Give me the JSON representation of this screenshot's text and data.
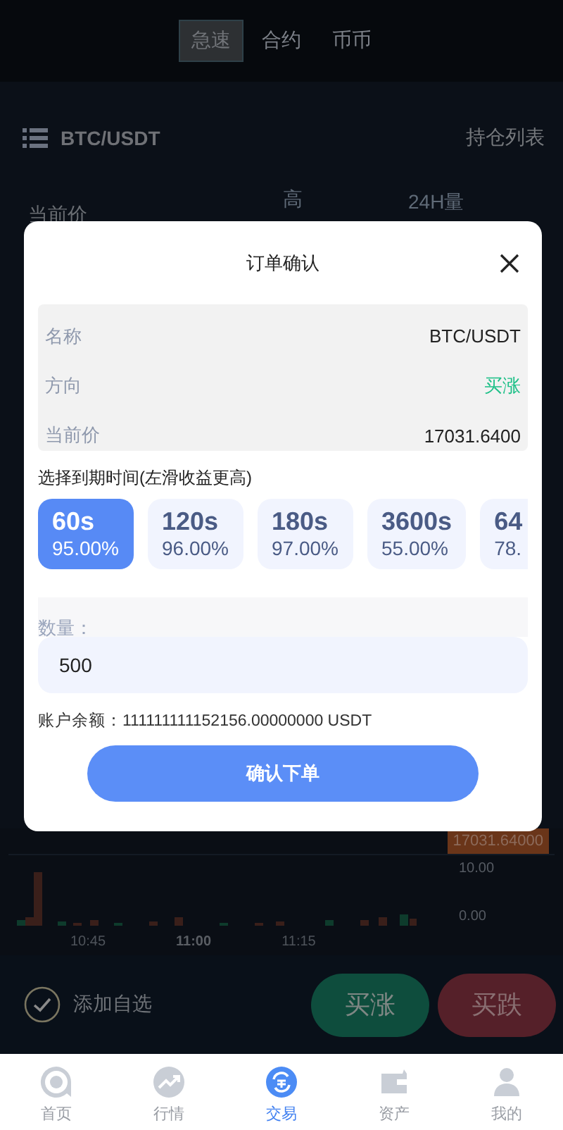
{
  "top_tabs": [
    {
      "label": "急速",
      "selected": true
    },
    {
      "label": "合约",
      "selected": false
    },
    {
      "label": "币币",
      "selected": false
    }
  ],
  "pair": "BTC/USDT",
  "positions_link": "持仓列表",
  "stats_headers": [
    "当前价",
    "高",
    "24H量"
  ],
  "chart": {
    "price_tag": "17031.64000",
    "y_labels": [
      "10.00",
      "0.00"
    ],
    "x_labels": [
      "10:45",
      "11:00",
      "11:15"
    ]
  },
  "watchlist_label": "添加自选",
  "trade_buttons": [
    {
      "label": "买涨",
      "kind": "up"
    },
    {
      "label": "买跌",
      "kind": "down"
    }
  ],
  "nav": [
    {
      "label": "首页",
      "selected": false
    },
    {
      "label": "行情",
      "selected": false
    },
    {
      "label": "交易",
      "selected": true
    },
    {
      "label": "资产",
      "selected": false
    },
    {
      "label": "我的",
      "selected": false
    }
  ],
  "modal": {
    "title": "订单确认",
    "rows": [
      {
        "label": "名称",
        "value": "BTC/USDT",
        "kind": "plain"
      },
      {
        "label": "方向",
        "value": "买涨",
        "kind": "up"
      },
      {
        "label": "当前价",
        "value": "17031.6400",
        "kind": "plain"
      }
    ],
    "period_label": "选择到期时间(左滑收益更高)",
    "periods": [
      {
        "duration": "60s",
        "rate": "95.00%",
        "selected": true
      },
      {
        "duration": "120s",
        "rate": "96.00%",
        "selected": false
      },
      {
        "duration": "180s",
        "rate": "97.00%",
        "selected": false
      },
      {
        "duration": "3600s",
        "rate": "55.00%",
        "selected": false
      },
      {
        "duration": "64",
        "rate": "78.",
        "selected": false
      }
    ],
    "quantity_label": "数量：",
    "quantity_value": "500",
    "balance": "账户余额：111111111152156.00000000 USDT",
    "confirm_button": "确认下单"
  }
}
